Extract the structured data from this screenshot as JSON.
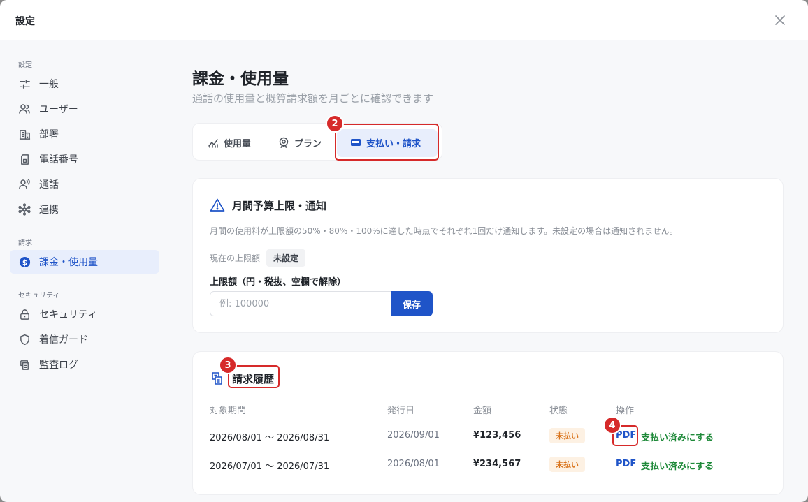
{
  "dialog": {
    "title": "設定"
  },
  "sidebar": {
    "sections": [
      {
        "label": "設定"
      },
      {
        "label": "請求"
      },
      {
        "label": "セキュリティ"
      }
    ],
    "items": [
      {
        "label": "一般",
        "icon": "sliders-icon"
      },
      {
        "label": "ユーザー",
        "icon": "users-icon"
      },
      {
        "label": "部署",
        "icon": "building-icon"
      },
      {
        "label": "電話番号",
        "icon": "sim-card-icon"
      },
      {
        "label": "通話",
        "icon": "call-voice-icon"
      },
      {
        "label": "連携",
        "icon": "network-icon"
      },
      {
        "label": "課金・使用量",
        "icon": "dollar-circle-icon",
        "active": true
      },
      {
        "label": "セキュリティ",
        "icon": "lock-icon"
      },
      {
        "label": "着信ガード",
        "icon": "shield-icon"
      },
      {
        "label": "監査ログ",
        "icon": "audit-log-icon"
      }
    ]
  },
  "main": {
    "title": "課金・使用量",
    "subtitle": "通話の使用量と概算請求額を月ごとに確認できます",
    "tabs": [
      {
        "label": "使用量",
        "icon": "chart-line-icon"
      },
      {
        "label": "プラン",
        "icon": "badge-icon"
      },
      {
        "label": "支払い・請求",
        "icon": "credit-card-icon",
        "active": true
      }
    ]
  },
  "budget": {
    "title": "月間予算上限・通知",
    "description": "月間の使用料が上限額の50%・80%・100%に達した時点でそれぞれ1回だけ通知します。未設定の場合は通知されません。",
    "current_label": "現在の上限額",
    "current_value": "未設定",
    "field_label": "上限額（円・税抜、空欄で解除）",
    "input_placeholder": "例: 100000",
    "input_value": "",
    "save_label": "保存"
  },
  "history": {
    "title": "請求履歴",
    "columns": [
      "対象期間",
      "発行日",
      "金額",
      "状態",
      "操作"
    ],
    "rows": [
      {
        "period": "2026/08/01 〜 2026/08/31",
        "issued": "2026/09/01",
        "amount": "¥123,456",
        "status": "未払い",
        "pdf": "PDF",
        "mark_paid": "支払い済みにする"
      },
      {
        "period": "2026/07/01 〜 2026/07/31",
        "issued": "2026/08/01",
        "amount": "¥234,567",
        "status": "未払い",
        "pdf": "PDF",
        "mark_paid": "支払い済みにする"
      }
    ]
  },
  "annotations": [
    "2",
    "3",
    "4"
  ],
  "colors": {
    "accent": "#1f54c8",
    "marker": "#d62a2a",
    "warning": "#d9741c",
    "success": "#1f8a3a"
  }
}
